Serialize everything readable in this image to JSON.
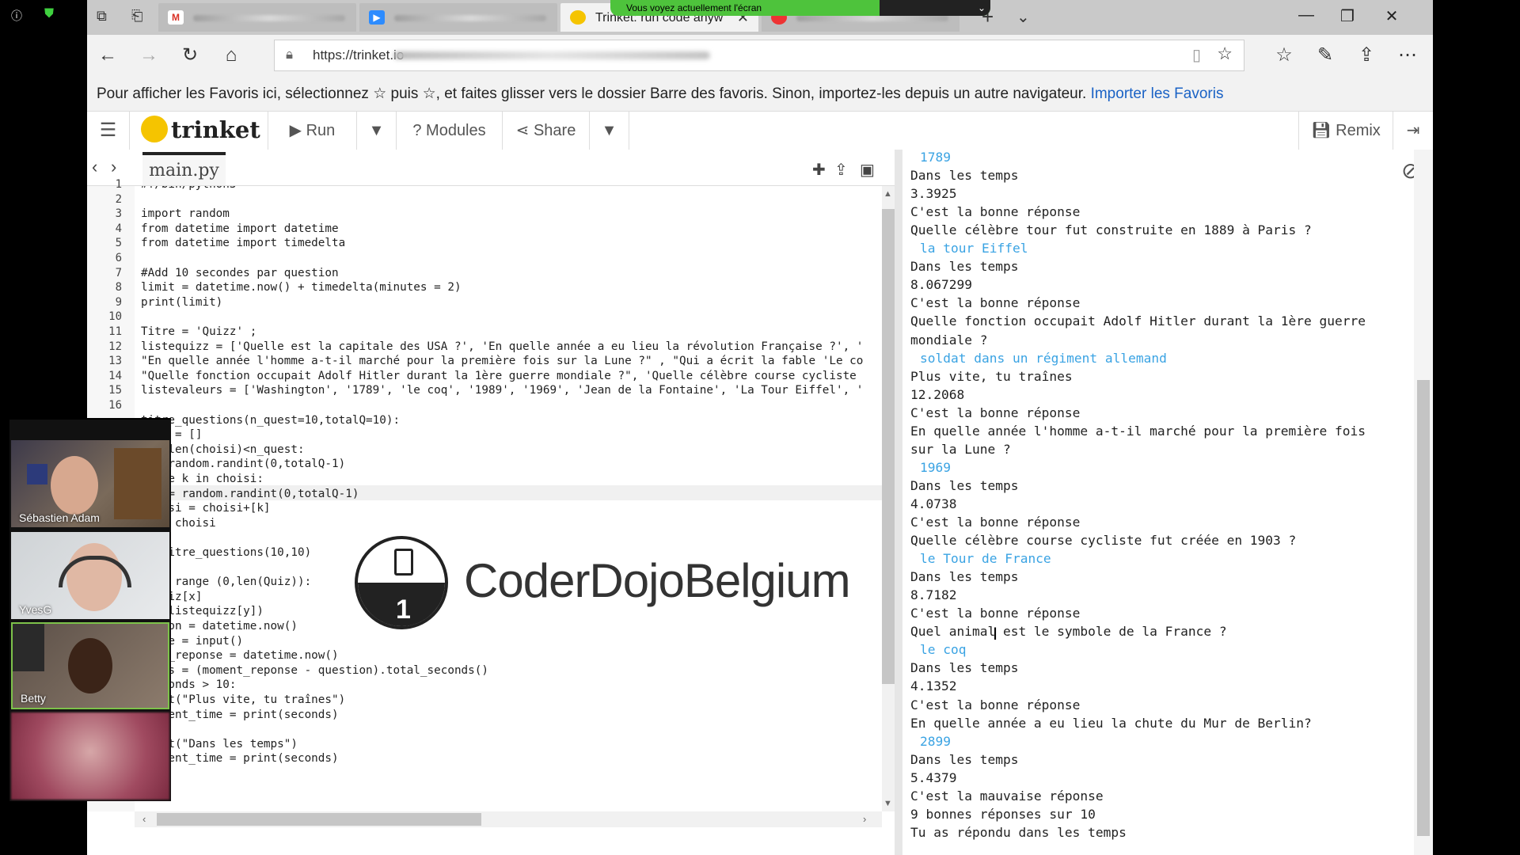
{
  "browser": {
    "tabs": [
      {
        "title": "Trinket: run code anyw",
        "active": true
      }
    ],
    "share_banner": "Vous voyez actuellement l'écran",
    "url": "https://trinket.io",
    "favorites_text": "Pour afficher les Favoris ici, sélectionnez ☆ puis ☆, et faites glisser vers le dossier Barre des favoris. Sinon, importez-les depuis un autre navigateur.",
    "favorites_link": "Importer les Favoris"
  },
  "trinket": {
    "logo": "trinket",
    "run_label": "Run",
    "modules_label": "Modules",
    "share_label": "Share",
    "remix_label": "Remix"
  },
  "editor": {
    "file_tab": "main.py",
    "line_numbers": [
      "1",
      "2",
      "3",
      "4",
      "5",
      "6",
      "7",
      "8",
      "9",
      "10",
      "11",
      "12",
      "13",
      "14",
      "15",
      "16"
    ],
    "lines": [
      "#!/bin/python3",
      "",
      "import random",
      "from datetime import datetime",
      "from datetime import timedelta",
      "",
      "#Add 10 secondes par question",
      "limit = datetime.now() + timedelta(minutes = 2)",
      "print(limit)",
      "",
      "Titre = 'Quizz' ;",
      "listequizz = ['Quelle est la capitale des USA ?', 'En quelle année a eu lieu la révolution Française ?', '",
      "\"En quelle année l'homme a-t-il marché pour la première fois sur la Lune ?\" , \"Qui a écrit la fable 'Le co",
      "\"Quelle fonction occupait Adolf Hitler durant la 1ère guerre mondiale ?\", 'Quelle célèbre course cycliste",
      "listevaleurs = ['Washington', '1789', 'le coq', '1989', '1969', 'Jean de la Fontaine', 'La Tour Eiffel', '",
      "",
      "titre_questions(n_quest=10,totalQ=10):",
      "oisi = []",
      "ile len(choisi)<n_quest:",
      "k = random.randint(0,totalQ-1)",
      "while k in choisi:",
      "  k = random.randint(0,totalQ-1)",
      "choisi = choisi+[k]",
      "turn choisi",
      "",
      " = titre_questions(10,10)",
      " = 0",
      "x in range (0,len(Quiz)):",
      "= Quiz[x]",
      "int(listequizz[y])",
      "estion = datetime.now()",
      "ponse = input()",
      "ment_reponse = datetime.now()",
      "conds = (moment_reponse - question).total_seconds()",
      " seconds > 10:",
      "print(\"Plus vite, tu traînes\")",
      "current_time = print(seconds)",
      "se:",
      "print(\"Dans les temps\")",
      "current_time = print(seconds)"
    ],
    "watermark": "CoderDojoBelgium"
  },
  "console": {
    "lines": [
      {
        "t": "1789",
        "in": true
      },
      {
        "t": "Dans les temps"
      },
      {
        "t": "3.3925"
      },
      {
        "t": "C'est la bonne réponse"
      },
      {
        "t": "Quelle célèbre tour fut construite en 1889 à Paris ?"
      },
      {
        "t": "la tour Eiffel",
        "in": true
      },
      {
        "t": "Dans les temps"
      },
      {
        "t": "8.067299"
      },
      {
        "t": "C'est la bonne réponse"
      },
      {
        "t": "Quelle fonction occupait Adolf Hitler durant la 1ère guerre"
      },
      {
        "t": "mondiale ?"
      },
      {
        "t": "soldat dans un régiment allemand",
        "in": true
      },
      {
        "t": "Plus vite, tu traînes"
      },
      {
        "t": "12.2068"
      },
      {
        "t": "C'est la bonne réponse"
      },
      {
        "t": "En quelle année l'homme a-t-il marché pour la première fois"
      },
      {
        "t": "sur la Lune ?"
      },
      {
        "t": "1969",
        "in": true
      },
      {
        "t": "Dans les temps"
      },
      {
        "t": "4.0738"
      },
      {
        "t": "C'est la bonne réponse"
      },
      {
        "t": "Quelle célèbre course cycliste fut créée en 1903 ?"
      },
      {
        "t": "le Tour de France",
        "in": true
      },
      {
        "t": "Dans les temps"
      },
      {
        "t": "8.7182"
      },
      {
        "t": "C'est la bonne réponse"
      },
      {
        "t": "Quel animal est le symbole de la France ?"
      },
      {
        "t": "le coq",
        "in": true
      },
      {
        "t": "Dans les temps"
      },
      {
        "t": "4.1352"
      },
      {
        "t": "C'est la bonne réponse"
      },
      {
        "t": "En quelle année a eu lieu la chute du Mur de Berlin?"
      },
      {
        "t": "2899",
        "in": true
      },
      {
        "t": "Dans les temps"
      },
      {
        "t": "5.4379"
      },
      {
        "t": "C'est la mauvaise réponse"
      },
      {
        "t": "9 bonnes réponses sur 10"
      },
      {
        "t": "Tu as répondu dans les temps"
      }
    ]
  },
  "video_call": {
    "participants": [
      {
        "name": "Sébastien Adam"
      },
      {
        "name": "YvesG"
      },
      {
        "name": "Betty"
      },
      {
        "name": ""
      }
    ]
  },
  "colors": {
    "trinket_yellow": "#f5c400",
    "console_input": "#3aa3e3",
    "share_banner": "#4ec33c",
    "link": "#1a62c5"
  }
}
